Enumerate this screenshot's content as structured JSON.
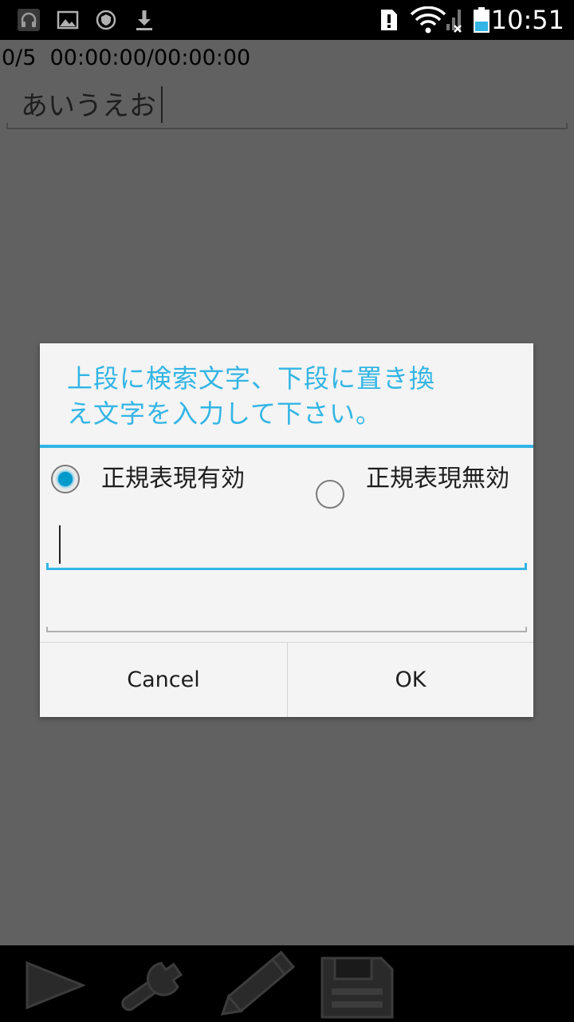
{
  "status_bar": {
    "time": "10:51",
    "left_icons": [
      "headset-icon",
      "image-icon",
      "shield-icon",
      "download-icon"
    ],
    "right_icons": [
      "alert-icon",
      "wifi-icon",
      "signal-icon",
      "battery-icon"
    ]
  },
  "app": {
    "counter": "0/5  00:00:00/00:00:00",
    "main_text": "あいうえお"
  },
  "dialog": {
    "title_line1": "上段に検索文字、下段に置き換",
    "title_line2": "え文字を入力して下さい。",
    "radio_on_label": "正規表現有効",
    "radio_off_label": "正規表現無効",
    "selected": "正規表現有効",
    "search_value": "",
    "replace_value": "",
    "cancel_label": "Cancel",
    "ok_label": "OK"
  },
  "toolbar": {
    "items": [
      "play-icon",
      "wrench-icon",
      "pencil-icon",
      "save-icon"
    ]
  },
  "colors": {
    "accent": "#33b5e5",
    "background": "#616161",
    "dialog_bg": "#f4f4f4"
  }
}
